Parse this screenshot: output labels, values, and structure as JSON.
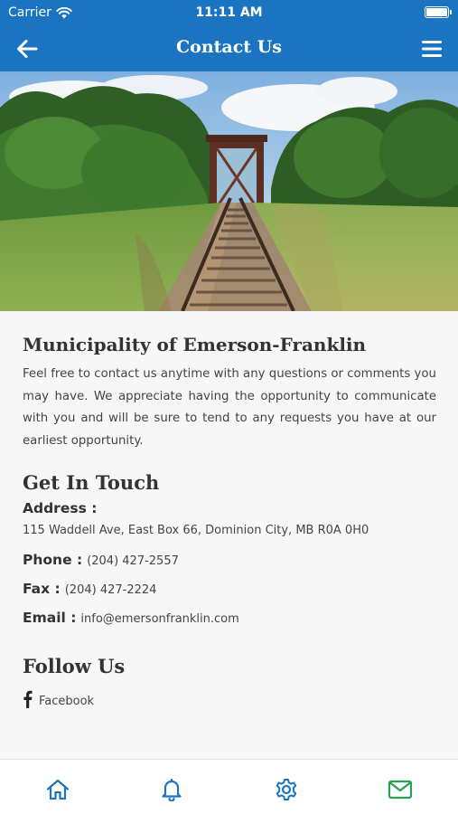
{
  "status_bar": {
    "carrier": "Carrier",
    "time": "11:11 AM",
    "battery": "full"
  },
  "nav": {
    "title": "Contact Us",
    "back_icon": "arrow-left-icon",
    "menu_icon": "hamburger-menu-icon"
  },
  "hero": {
    "alt": "railroad tracks leading to a steel bridge through trees"
  },
  "content": {
    "org_title": "Municipality of Emerson-Franklin",
    "intro": "Feel free to contact us anytime with any questions or comments you may have. We appreciate having the opportunity to communicate with you and will be sure to tend to any requests you have at our earliest opportunity.",
    "get_in_touch": "Get In Touch",
    "address_label": "Address :",
    "address_value": "115 Waddell Ave, East Box 66, Dominion City, MB R0A 0H0",
    "phone_label": "Phone :",
    "phone_value": "(204) 427-2557",
    "fax_label": "Fax :",
    "fax_value": "(204) 427-2224",
    "email_label": "Email :",
    "email_value": "info@emersonfranklin.com",
    "follow_us": "Follow Us",
    "facebook_label": "Facebook"
  },
  "tabbar": {
    "tabs": [
      {
        "icon": "home-icon",
        "color": "#1b74c1"
      },
      {
        "icon": "bell-icon",
        "color": "#1b74c1"
      },
      {
        "icon": "gear-icon",
        "color": "#1b74c1"
      },
      {
        "icon": "mail-icon",
        "color": "#27a050"
      }
    ]
  },
  "colors": {
    "header_bg": "#1b74c1",
    "active_tab": "#27a050",
    "background": "#f7f7f7"
  }
}
